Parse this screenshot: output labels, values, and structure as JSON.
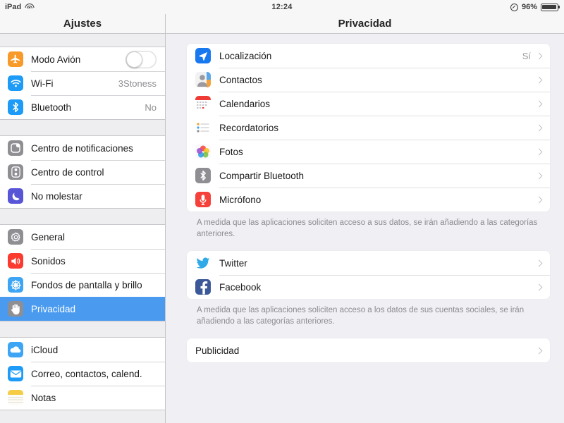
{
  "statusbar": {
    "device_label": "iPad",
    "wifi_icon": "wifi-icon",
    "time": "12:24",
    "rotation_lock_icon": "rotation-lock-icon",
    "battery_percent": "96%",
    "battery_icon": "battery-icon"
  },
  "sidebar": {
    "title": "Ajustes",
    "groups": [
      {
        "items": [
          {
            "label": "Modo Avión",
            "icon": "airplane-icon",
            "color": "#f79a2a",
            "control": "toggle",
            "toggle_on": false
          },
          {
            "label": "Wi-Fi",
            "icon": "wifi-icon",
            "color": "#1d9bf6",
            "value": "3Stoness"
          },
          {
            "label": "Bluetooth",
            "icon": "bluetooth-icon",
            "color": "#1d9bf6",
            "value": "No"
          }
        ]
      },
      {
        "items": [
          {
            "label": "Centro de notificaciones",
            "icon": "notification-center-icon",
            "color": "#8e8e93"
          },
          {
            "label": "Centro de control",
            "icon": "control-center-icon",
            "color": "#8e8e93"
          },
          {
            "label": "No molestar",
            "icon": "moon-icon",
            "color": "#5856d6"
          }
        ]
      },
      {
        "items": [
          {
            "label": "General",
            "icon": "gear-icon",
            "color": "#8e8e93"
          },
          {
            "label": "Sonidos",
            "icon": "speaker-icon",
            "color": "#fb3b30"
          },
          {
            "label": "Fondos de pantalla y brillo",
            "icon": "wallpaper-icon",
            "color": "#3da5f4"
          },
          {
            "label": "Privacidad",
            "icon": "hand-icon",
            "color": "#8e8e93",
            "selected": true
          }
        ]
      },
      {
        "items": [
          {
            "label": "iCloud",
            "icon": "icloud-icon",
            "color": "#3da5f4"
          },
          {
            "label": "Correo, contactos, calend.",
            "icon": "mail-icon",
            "color": "#1d9bf6"
          },
          {
            "label": "Notas",
            "icon": "notes-icon",
            "color": "#f5cc46"
          }
        ]
      }
    ]
  },
  "main": {
    "title": "Privacidad",
    "sections": [
      {
        "rows": [
          {
            "label": "Localización",
            "icon": "location-arrow-icon",
            "value": "Sí"
          },
          {
            "label": "Contactos",
            "icon": "contacts-icon"
          },
          {
            "label": "Calendarios",
            "icon": "calendar-icon"
          },
          {
            "label": "Recordatorios",
            "icon": "reminders-icon"
          },
          {
            "label": "Fotos",
            "icon": "photos-icon"
          },
          {
            "label": "Compartir Bluetooth",
            "icon": "bluetooth-icon"
          },
          {
            "label": "Micrófono",
            "icon": "microphone-icon"
          }
        ],
        "footnote": "A medida que las aplicaciones soliciten acceso a sus datos, se irán añadiendo a las categorías anteriores."
      },
      {
        "rows": [
          {
            "label": "Twitter",
            "icon": "twitter-icon"
          },
          {
            "label": "Facebook",
            "icon": "facebook-icon"
          }
        ],
        "footnote": "A medida que las aplicaciones soliciten acceso a los datos de sus cuentas sociales, se irán añadiendo a las categorías anteriores."
      },
      {
        "rows": [
          {
            "label": "Publicidad",
            "icon": null
          }
        ],
        "footnote": ""
      }
    ]
  },
  "colors": {
    "accent": "#4a9bf0",
    "panel_bg": "#efeff4",
    "sidebar_bg": "#eeeef1",
    "card_bg": "#ffffff"
  }
}
